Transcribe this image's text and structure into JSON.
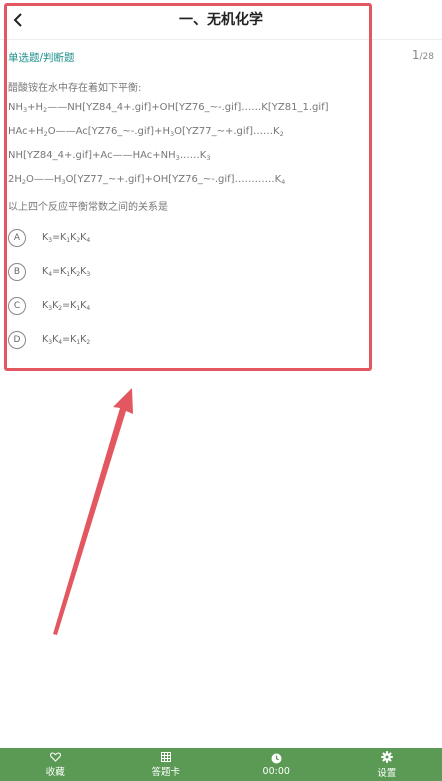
{
  "header": {
    "title": "一、无机化学"
  },
  "question": {
    "type": "单选题/判断题",
    "current": "1",
    "total": "/28",
    "stem": "醋酸铵在水中存在着如下平衡:",
    "lines": [
      {
        "parts": [
          "NH",
          "3",
          "+H",
          "2",
          "——NH[YZ84_4+.gif]+OH[YZ76_~-.gif]……K[YZ81_1.gif]"
        ]
      },
      {
        "parts": [
          "HAc+H",
          "2",
          "O——Ac[YZ76_~-.gif]+H",
          "3",
          "O[YZ77_~+.gif]……K",
          "2",
          ""
        ]
      },
      {
        "parts": [
          "NH[YZ84_4+.gif]+Ac——HAc+NH",
          "3",
          "……K",
          "3",
          ""
        ]
      },
      {
        "parts": [
          "2H",
          "2",
          "O——H",
          "3",
          "O[YZ77_~+.gif]+OH[YZ76_~-.gif]…………K",
          "4",
          ""
        ]
      }
    ],
    "prompt": "以上四个反应平衡常数之间的关系是",
    "options": [
      {
        "letter": "A",
        "parts": [
          "K",
          "3",
          "=K",
          "1",
          "K",
          "2",
          "K",
          "4",
          ""
        ]
      },
      {
        "letter": "B",
        "parts": [
          "K",
          "4",
          "=K",
          "1",
          "K",
          "2",
          "K",
          "3",
          ""
        ]
      },
      {
        "letter": "C",
        "parts": [
          "K",
          "3",
          "K",
          "2",
          "=K",
          "1",
          "K",
          "4",
          ""
        ]
      },
      {
        "letter": "D",
        "parts": [
          "K",
          "3",
          "K",
          "4",
          "=K",
          "1",
          "K",
          "2",
          ""
        ]
      }
    ]
  },
  "bottom_bar": {
    "tabs": [
      {
        "label": "收藏",
        "icon": "heart-icon"
      },
      {
        "label": "答题卡",
        "icon": "grid-icon"
      },
      {
        "label": "00:00",
        "icon": "clock-icon"
      },
      {
        "label": "设置",
        "icon": "gear-icon"
      }
    ]
  },
  "colors": {
    "accent": "#1e8f8a",
    "bar": "#5a9a54",
    "annotation": "#e35761"
  }
}
